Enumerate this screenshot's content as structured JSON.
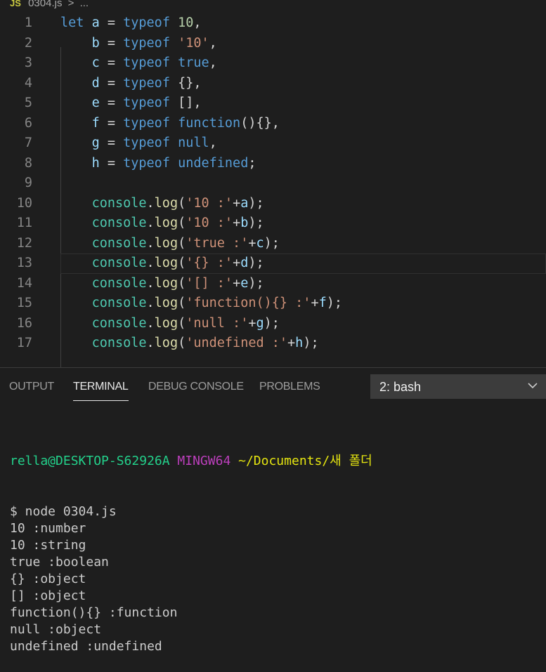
{
  "breadcrumb": {
    "file_icon": "JS",
    "file_name": "0304.js",
    "separator": ">",
    "ellipsis": "..."
  },
  "editor": {
    "current_line": 13,
    "lines": [
      {
        "n": "1",
        "tokens": [
          [
            "kw",
            "let"
          ],
          [
            "plain",
            " "
          ],
          [
            "var",
            "a"
          ],
          [
            "plain",
            " = "
          ],
          [
            "kw",
            "typeof"
          ],
          [
            "plain",
            " "
          ],
          [
            "num",
            "10"
          ],
          [
            "plain",
            ","
          ]
        ]
      },
      {
        "n": "2",
        "tokens": [
          [
            "plain",
            "    "
          ],
          [
            "var",
            "b"
          ],
          [
            "plain",
            " = "
          ],
          [
            "kw",
            "typeof"
          ],
          [
            "plain",
            " "
          ],
          [
            "str",
            "'10'"
          ],
          [
            "plain",
            ","
          ]
        ]
      },
      {
        "n": "3",
        "tokens": [
          [
            "plain",
            "    "
          ],
          [
            "var",
            "c"
          ],
          [
            "plain",
            " = "
          ],
          [
            "kw",
            "typeof"
          ],
          [
            "plain",
            " "
          ],
          [
            "kw",
            "true"
          ],
          [
            "plain",
            ","
          ]
        ]
      },
      {
        "n": "4",
        "tokens": [
          [
            "plain",
            "    "
          ],
          [
            "var",
            "d"
          ],
          [
            "plain",
            " = "
          ],
          [
            "kw",
            "typeof"
          ],
          [
            "plain",
            " {},"
          ]
        ]
      },
      {
        "n": "5",
        "tokens": [
          [
            "plain",
            "    "
          ],
          [
            "var",
            "e"
          ],
          [
            "plain",
            " = "
          ],
          [
            "kw",
            "typeof"
          ],
          [
            "plain",
            " [],"
          ]
        ]
      },
      {
        "n": "6",
        "tokens": [
          [
            "plain",
            "    "
          ],
          [
            "var",
            "f"
          ],
          [
            "plain",
            " = "
          ],
          [
            "kw",
            "typeof"
          ],
          [
            "plain",
            " "
          ],
          [
            "kw",
            "function"
          ],
          [
            "plain",
            "(){},"
          ]
        ]
      },
      {
        "n": "7",
        "tokens": [
          [
            "plain",
            "    "
          ],
          [
            "var",
            "g"
          ],
          [
            "plain",
            " = "
          ],
          [
            "kw",
            "typeof"
          ],
          [
            "plain",
            " "
          ],
          [
            "kw",
            "null"
          ],
          [
            "plain",
            ","
          ]
        ]
      },
      {
        "n": "8",
        "tokens": [
          [
            "plain",
            "    "
          ],
          [
            "var",
            "h"
          ],
          [
            "plain",
            " = "
          ],
          [
            "kw",
            "typeof"
          ],
          [
            "plain",
            " "
          ],
          [
            "kw",
            "undefined"
          ],
          [
            "plain",
            ";"
          ]
        ]
      },
      {
        "n": "9",
        "tokens": []
      },
      {
        "n": "10",
        "tokens": [
          [
            "plain",
            "    "
          ],
          [
            "obj",
            "console"
          ],
          [
            "plain",
            "."
          ],
          [
            "fn",
            "log"
          ],
          [
            "plain",
            "("
          ],
          [
            "str",
            "'10 :'"
          ],
          [
            "plain",
            "+"
          ],
          [
            "var",
            "a"
          ],
          [
            "plain",
            ");"
          ]
        ]
      },
      {
        "n": "11",
        "tokens": [
          [
            "plain",
            "    "
          ],
          [
            "obj",
            "console"
          ],
          [
            "plain",
            "."
          ],
          [
            "fn",
            "log"
          ],
          [
            "plain",
            "("
          ],
          [
            "str",
            "'10 :'"
          ],
          [
            "plain",
            "+"
          ],
          [
            "var",
            "b"
          ],
          [
            "plain",
            ");"
          ]
        ]
      },
      {
        "n": "12",
        "tokens": [
          [
            "plain",
            "    "
          ],
          [
            "obj",
            "console"
          ],
          [
            "plain",
            "."
          ],
          [
            "fn",
            "log"
          ],
          [
            "plain",
            "("
          ],
          [
            "str",
            "'true :'"
          ],
          [
            "plain",
            "+"
          ],
          [
            "var",
            "c"
          ],
          [
            "plain",
            ");"
          ]
        ]
      },
      {
        "n": "13",
        "tokens": [
          [
            "plain",
            "    "
          ],
          [
            "obj",
            "console"
          ],
          [
            "plain",
            "."
          ],
          [
            "fn",
            "log"
          ],
          [
            "plain",
            "("
          ],
          [
            "str",
            "'{} :'"
          ],
          [
            "plain",
            "+"
          ],
          [
            "var",
            "d"
          ],
          [
            "plain",
            ");"
          ]
        ]
      },
      {
        "n": "14",
        "tokens": [
          [
            "plain",
            "    "
          ],
          [
            "obj",
            "console"
          ],
          [
            "plain",
            "."
          ],
          [
            "fn",
            "log"
          ],
          [
            "plain",
            "("
          ],
          [
            "str",
            "'[] :'"
          ],
          [
            "plain",
            "+"
          ],
          [
            "var",
            "e"
          ],
          [
            "plain",
            ");"
          ]
        ]
      },
      {
        "n": "15",
        "tokens": [
          [
            "plain",
            "    "
          ],
          [
            "obj",
            "console"
          ],
          [
            "plain",
            "."
          ],
          [
            "fn",
            "log"
          ],
          [
            "plain",
            "("
          ],
          [
            "str",
            "'function(){} :'"
          ],
          [
            "plain",
            "+"
          ],
          [
            "var",
            "f"
          ],
          [
            "plain",
            ");"
          ]
        ]
      },
      {
        "n": "16",
        "tokens": [
          [
            "plain",
            "    "
          ],
          [
            "obj",
            "console"
          ],
          [
            "plain",
            "."
          ],
          [
            "fn",
            "log"
          ],
          [
            "plain",
            "("
          ],
          [
            "str",
            "'null :'"
          ],
          [
            "plain",
            "+"
          ],
          [
            "var",
            "g"
          ],
          [
            "plain",
            ");"
          ]
        ]
      },
      {
        "n": "17",
        "tokens": [
          [
            "plain",
            "    "
          ],
          [
            "obj",
            "console"
          ],
          [
            "plain",
            "."
          ],
          [
            "fn",
            "log"
          ],
          [
            "plain",
            "("
          ],
          [
            "str",
            "'undefined :'"
          ],
          [
            "plain",
            "+"
          ],
          [
            "var",
            "h"
          ],
          [
            "plain",
            ");"
          ]
        ]
      }
    ]
  },
  "panel": {
    "tabs": [
      {
        "label": "OUTPUT",
        "active": false
      },
      {
        "label": "TERMINAL",
        "active": true
      },
      {
        "label": "DEBUG CONSOLE",
        "active": false
      },
      {
        "label": "PROBLEMS",
        "active": false
      }
    ],
    "terminal_select": {
      "value": "2: bash",
      "icon": "chevron-down-icon"
    }
  },
  "terminal": {
    "prompt_user": "rella@DESKTOP-S62926A",
    "prompt_system": "MINGW64",
    "prompt_path": "~/Documents/새 폴더",
    "output": [
      "$ node 0304.js",
      "10 :number",
      "10 :string",
      "true :boolean",
      "{} :object",
      "[] :object",
      "function(){} :function",
      "null :object",
      "undefined :undefined"
    ]
  }
}
